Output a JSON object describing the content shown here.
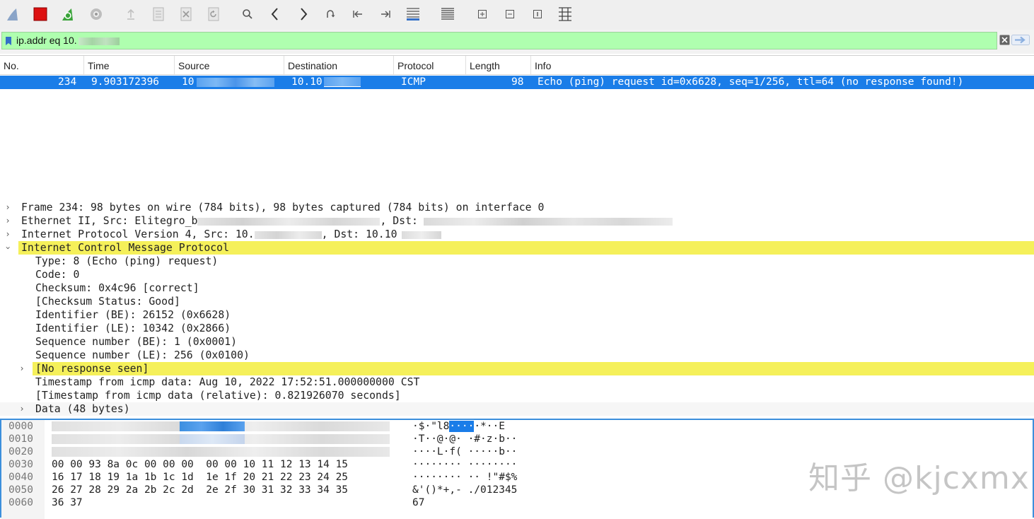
{
  "toolbar": {
    "buttons": [
      {
        "name": "start-capture",
        "icon": "shark-fin-icon"
      },
      {
        "name": "stop-capture",
        "icon": "stop-square-icon"
      },
      {
        "name": "restart-capture",
        "icon": "restart-fin-icon"
      },
      {
        "name": "capture-options",
        "icon": "gear-icon"
      },
      {
        "name": "open-file",
        "icon": "open-file-icon"
      },
      {
        "name": "save-file",
        "icon": "save-file-icon"
      },
      {
        "name": "close-file",
        "icon": "close-file-icon"
      },
      {
        "name": "reload-file",
        "icon": "reload-icon"
      },
      {
        "name": "find-packet",
        "icon": "search-icon"
      },
      {
        "name": "go-back",
        "icon": "chevron-left-icon"
      },
      {
        "name": "go-forward",
        "icon": "chevron-right-icon"
      },
      {
        "name": "go-to-packet",
        "icon": "jump-icon"
      },
      {
        "name": "first-packet",
        "icon": "first-packet-icon"
      },
      {
        "name": "last-packet",
        "icon": "last-packet-icon"
      },
      {
        "name": "autoscroll",
        "icon": "autoscroll-icon"
      },
      {
        "name": "colorize",
        "icon": "colorize-icon"
      },
      {
        "name": "zoom-in",
        "icon": "zoom-in-icon"
      },
      {
        "name": "zoom-out",
        "icon": "zoom-out-icon"
      },
      {
        "name": "normal-size",
        "icon": "normal-size-icon"
      },
      {
        "name": "resize-columns",
        "icon": "resize-columns-icon"
      }
    ]
  },
  "filter": {
    "value": "ip.addr eq 10.",
    "background": "#afffaf"
  },
  "packet_list": {
    "columns": [
      "No.",
      "Time",
      "Source",
      "Destination",
      "Protocol",
      "Length",
      "Info"
    ],
    "rows": [
      {
        "no": "234",
        "time": "9.903172396",
        "source": "10",
        "destination": "10.10",
        "protocol": "ICMP",
        "length": "98",
        "info": "Echo (ping) request  id=0x6628, seq=1/256, ttl=64 (no response found!)"
      }
    ],
    "selected_color": "#1a7de8"
  },
  "details": {
    "frame": "Frame 234: 98 bytes on wire (784 bits), 98 bytes captured (784 bits) on interface 0",
    "ethernet_prefix": "Ethernet II, Src: Elitegro_b",
    "ethernet_dst": ", Dst:",
    "ip_prefix": "Internet Protocol Version 4, Src: 10.",
    "ip_dst": ", Dst: 10.10",
    "icmp": "Internet Control Message Protocol",
    "fields": [
      "Type: 8 (Echo (ping) request)",
      "Code: 0",
      "Checksum: 0x4c96 [correct]",
      "[Checksum Status: Good]",
      "Identifier (BE): 26152 (0x6628)",
      "Identifier (LE): 10342 (0x2866)",
      "Sequence number (BE): 1 (0x0001)",
      "Sequence number (LE): 256 (0x0100)"
    ],
    "no_response": "[No response seen]",
    "timestamp": "Timestamp from icmp data: Aug 10, 2022 17:52:51.000000000 CST",
    "timestamp_rel": "[Timestamp from icmp data (relative): 0.821926070 seconds]",
    "data": "Data (48 bytes)",
    "highlight_color": "#f5f05a"
  },
  "bytes": {
    "rows": [
      {
        "offset": "0000",
        "hex": "",
        "ascii": "·$·\"l8"
      },
      {
        "offset": "0010",
        "hex": "",
        "ascii": "·T··@·@·  ·#·z·b··"
      },
      {
        "offset": "0020",
        "hex": "",
        "ascii": "····L·f(  ·····b··"
      },
      {
        "offset": "0030",
        "hex": "00 00 93 8a 0c 00 00 00  00 00 10 11 12 13 14 15",
        "ascii": "········ ········"
      },
      {
        "offset": "0040",
        "hex": "16 17 18 19 1a 1b 1c 1d  1e 1f 20 21 22 23 24 25",
        "ascii": "········ ·· !\"#$%"
      },
      {
        "offset": "0050",
        "hex": "26 27 28 29 2a 2b 2c 2d  2e 2f 30 31 32 33 34 35",
        "ascii": "&'()*+,- ./012345"
      },
      {
        "offset": "0060",
        "hex": "36 37",
        "ascii": "67"
      }
    ],
    "row0_ascii_tail": "·*··E",
    "row0_ascii_sel": "····"
  },
  "watermark": "知乎 @kjcxmx"
}
